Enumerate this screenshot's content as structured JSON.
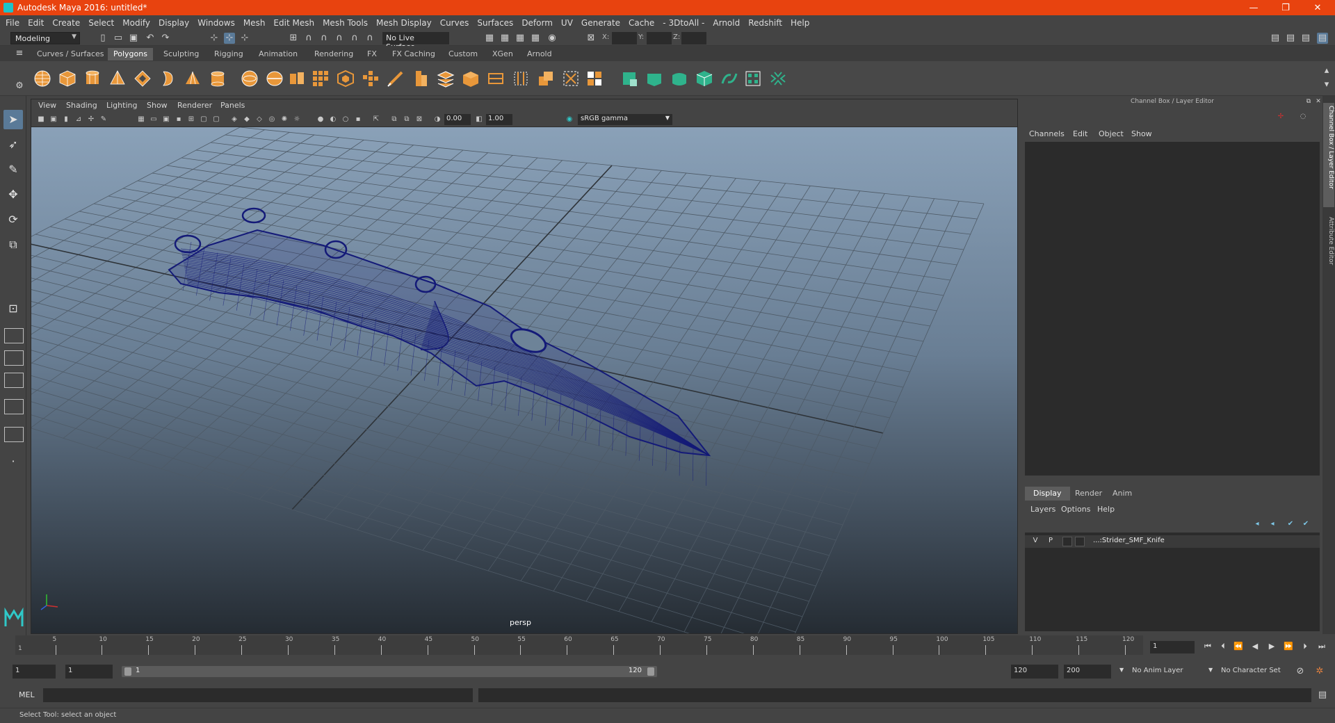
{
  "window": {
    "title": "Autodesk Maya 2016: untitled*",
    "controls": {
      "minimize": "—",
      "maximize": "❐",
      "close": "✕"
    }
  },
  "menu": [
    "File",
    "Edit",
    "Create",
    "Select",
    "Modify",
    "Display",
    "Windows",
    "Mesh",
    "Edit Mesh",
    "Mesh Tools",
    "Mesh Display",
    "Curves",
    "Surfaces",
    "Deform",
    "UV",
    "Generate",
    "Cache",
    "- 3DtoAll -",
    "Arnold",
    "Redshift",
    "Help"
  ],
  "status": {
    "mode": "Modeling",
    "live_surface": "No Live Surface",
    "xyz": [
      "X:",
      "Y:",
      "Z:"
    ]
  },
  "shelf_tabs": [
    "Curves / Surfaces",
    "Polygons",
    "Sculpting",
    "Rigging",
    "Animation",
    "Rendering",
    "FX",
    "FX Caching",
    "Custom",
    "XGen",
    "Arnold"
  ],
  "shelf_active": "Polygons",
  "viewport": {
    "menu": [
      "View",
      "Shading",
      "Lighting",
      "Show",
      "Renderer",
      "Panels"
    ],
    "exposure": "0.00",
    "gamma": "1.00",
    "color_space": "sRGB gamma",
    "camera": "persp"
  },
  "channel_box": {
    "title": "Channel Box / Layer Editor",
    "menu": [
      "Channels",
      "Edit",
      "Object",
      "Show"
    ]
  },
  "layer_editor": {
    "tabs": [
      "Display",
      "Render",
      "Anim"
    ],
    "active_tab": "Display",
    "menu": [
      "Layers",
      "Options",
      "Help"
    ],
    "layer": {
      "v": "V",
      "p": "P",
      "name": "...:Strider_SMF_Knife"
    }
  },
  "side_tabs": [
    "Channel Box / Layer Editor",
    "Attribute Editor"
  ],
  "timeline": {
    "ticks": [
      5,
      10,
      15,
      20,
      25,
      30,
      35,
      40,
      45,
      50,
      55,
      60,
      65,
      70,
      75,
      80,
      85,
      90,
      95,
      100,
      105,
      110,
      115,
      120
    ],
    "start_label": "1",
    "current_frame": "1"
  },
  "range": {
    "start": "1",
    "playback_start": "1",
    "slider_start": "1",
    "slider_end": "120",
    "playback_end": "120",
    "end": "200",
    "anim_layer": "No Anim Layer",
    "character_set": "No Character Set"
  },
  "command_line": {
    "label": "MEL"
  },
  "help_line": "Select Tool: select an object",
  "colors": {
    "title_bar": "#e8430f",
    "wireframe": "#141a78",
    "accent": "#5a7a98"
  }
}
